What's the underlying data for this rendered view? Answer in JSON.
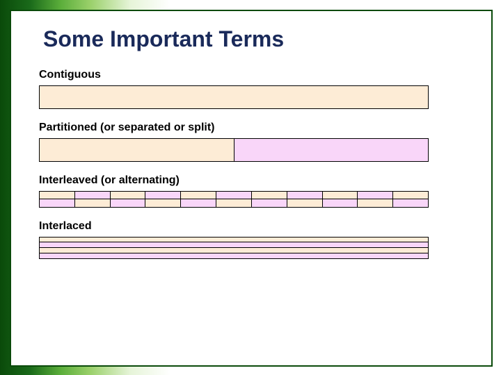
{
  "slide": {
    "title": "Some Important Terms",
    "terms": {
      "contiguous": {
        "label": "Contiguous"
      },
      "partitioned": {
        "label": "Partitioned (or separated or split)"
      },
      "interleaved": {
        "label": "Interleaved (or alternating)"
      },
      "interlaced": {
        "label": "Interlaced"
      }
    },
    "colors": {
      "peach": "#fdecd6",
      "pink": "#f9d6f9",
      "border": "#000000",
      "outerBorder": "#0a4a0a",
      "titleColor": "#1a2a5a"
    },
    "diagrams": {
      "contiguous": {
        "segments": [
          "peach"
        ]
      },
      "partitioned": {
        "segments": [
          "peach",
          "pink"
        ]
      },
      "interleaved": {
        "rows": 2,
        "cellsPerRow": 11,
        "row0StartColor": "peach",
        "row1StartColor": "pink"
      },
      "interlaced": {
        "rows": 4,
        "pattern": [
          "peach",
          "pink",
          "peach",
          "pink"
        ]
      }
    }
  }
}
